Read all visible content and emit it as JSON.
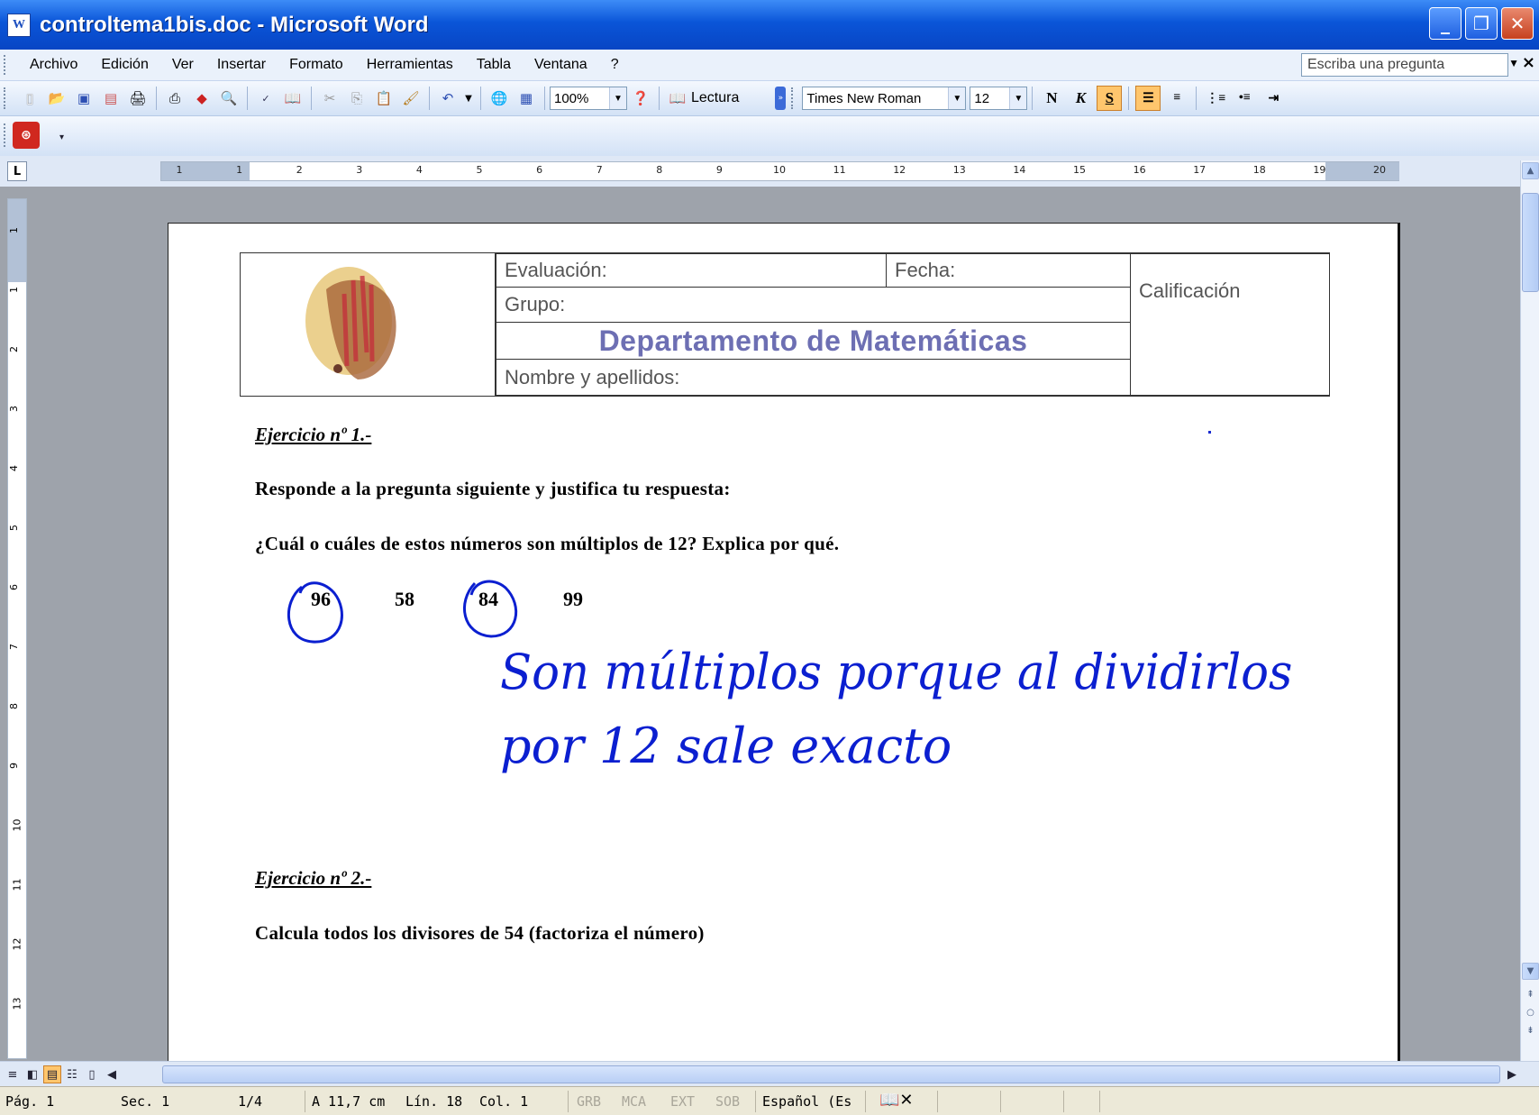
{
  "window": {
    "title": "controltema1bis.doc - Microsoft Word"
  },
  "menu": {
    "items": [
      "Archivo",
      "Edición",
      "Ver",
      "Insertar",
      "Formato",
      "Herramientas",
      "Tabla",
      "Ventana",
      "?"
    ],
    "ask_placeholder": "Escriba una pregunta"
  },
  "toolbar": {
    "zoom": "100%",
    "reading_label": "Lectura",
    "font_name": "Times New Roman",
    "font_size": "12",
    "bold": "N",
    "italic": "K",
    "underline": "S",
    "icons": [
      "new-icon",
      "open-icon",
      "save-icon",
      "permission-icon",
      "email-icon",
      "print-icon",
      "research-icon",
      "print-preview-icon",
      "spelling-icon",
      "research-book-icon",
      "cut-icon",
      "copy-icon",
      "paste-icon",
      "format-painter-icon",
      "undo-icon",
      "hyperlink-icon",
      "table-icon",
      "help-icon"
    ]
  },
  "ruler": {
    "h_numbers": [
      "1",
      "1",
      "2",
      "3",
      "4",
      "5",
      "6",
      "7",
      "8",
      "9",
      "10",
      "11",
      "12",
      "13",
      "14",
      "15",
      "16",
      "17",
      "18",
      "19",
      "20"
    ],
    "v_numbers": [
      "1",
      "1",
      "2",
      "3",
      "4",
      "5",
      "6",
      "7",
      "8",
      "9",
      "10",
      "11",
      "12",
      "13"
    ]
  },
  "document": {
    "header": {
      "evaluacion": "Evaluación:",
      "fecha": "Fecha:",
      "calificacion": "Calificación",
      "grupo": "Grupo:",
      "departamento": "Departamento  de  Matemáticas",
      "nombre": "Nombre y apellidos:"
    },
    "ej1_title": "Ejercicio nº 1.-",
    "ej1_instruction": "Responde a la pregunta siguiente y justifica tu respuesta:",
    "ej1_question": "¿Cuál o cuáles de estos números son múltiplos de 12? Explica por qué.",
    "numbers": [
      "96",
      "58",
      "84",
      "99"
    ],
    "handwritten_line1": "Son múltiplos porque al dividirlos",
    "handwritten_line2": "por 12 sale exacto",
    "ej2_title": "Ejercicio nº 2.-",
    "ej2_question": "Calcula todos los divisores de 54 (factoriza el número)"
  },
  "status": {
    "page": "Pág. 1",
    "section": "Sec. 1",
    "pages": "1/4",
    "at": "A 11,7 cm",
    "line": "Lín. 18",
    "col": "Col. 1",
    "grb": "GRB",
    "mca": "MCA",
    "ext": "EXT",
    "sob": "SOB",
    "language": "Español (Es"
  },
  "colors": {
    "ink": "#0b1fd0",
    "dept": "#6d6fb3",
    "titlebar": "#0a55d8"
  }
}
